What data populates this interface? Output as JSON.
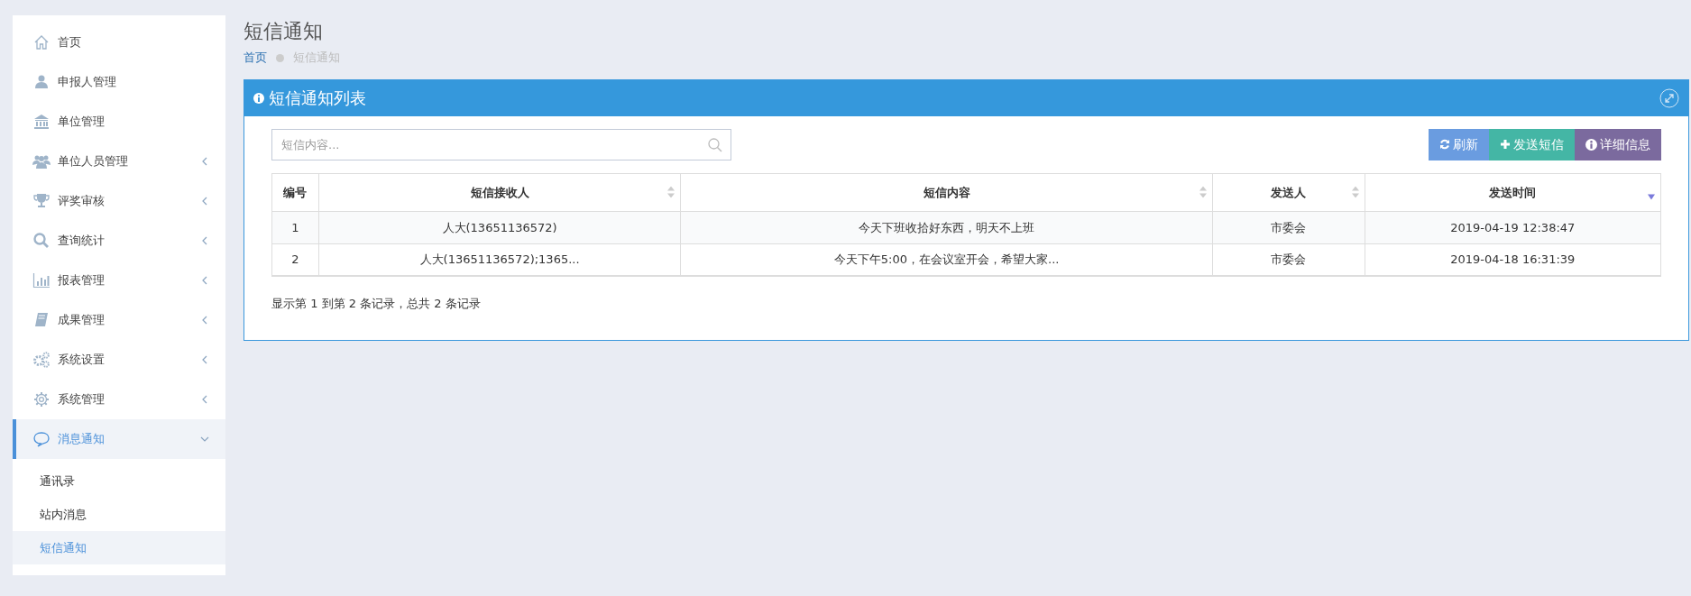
{
  "sidebar": {
    "items": [
      {
        "label": "首页",
        "selected": false
      },
      {
        "label": "申报人管理",
        "selected": false
      },
      {
        "label": "单位管理",
        "selected": false
      },
      {
        "label": "单位人员管理",
        "selected": false,
        "expanded": false
      },
      {
        "label": "评奖审核",
        "selected": false,
        "expanded": false
      },
      {
        "label": "查询统计",
        "selected": false,
        "expanded": false
      },
      {
        "label": "报表管理",
        "selected": false,
        "expanded": false
      },
      {
        "label": "成果管理",
        "selected": false,
        "expanded": false
      },
      {
        "label": "系统设置",
        "selected": false,
        "expanded": false
      },
      {
        "label": "系统管理",
        "selected": false,
        "expanded": false
      },
      {
        "label": "消息通知",
        "selected": true,
        "expanded": true,
        "children": [
          {
            "label": "通讯录",
            "selected": false
          },
          {
            "label": "站内消息",
            "selected": false
          },
          {
            "label": "短信通知",
            "selected": true
          }
        ]
      }
    ]
  },
  "page_title": "短信通知",
  "breadcrumb": [
    {
      "label": "首页",
      "current": false
    },
    {
      "label": "短信通知",
      "current": true
    }
  ],
  "panel": {
    "title": "短信通知列表",
    "search": {
      "placeholder": "短信内容..."
    },
    "buttons": [
      {
        "label": "刷新",
        "kind": "refresh"
      },
      {
        "label": "发送短信",
        "kind": "add"
      },
      {
        "label": "详细信息",
        "kind": "info"
      }
    ],
    "table": {
      "columns": [
        {
          "label": "编号",
          "sortable": false,
          "sorted_descending": false
        },
        {
          "label": "短信接收人",
          "sortable": true,
          "sorted_descending": false
        },
        {
          "label": "短信内容",
          "sortable": true,
          "sorted_descending": false
        },
        {
          "label": "发送人",
          "sortable": true,
          "sorted_descending": false
        },
        {
          "label": "发送时间",
          "sortable": true,
          "sorted_descending": true
        }
      ],
      "rows": [
        [
          "1",
          "人大(13651136572)",
          "今天下班收拾好东西，明天不上班",
          "市委会",
          "2019-04-19 12:38:47"
        ],
        [
          "2",
          "人大(13651136572);1365...",
          "今天下午5:00，在会议室开会，希望大家...",
          "市委会",
          "2019-04-18 16:31:39"
        ]
      ]
    },
    "footer": "显示第 1 到第 2 条记录，总共 2 条记录"
  }
}
